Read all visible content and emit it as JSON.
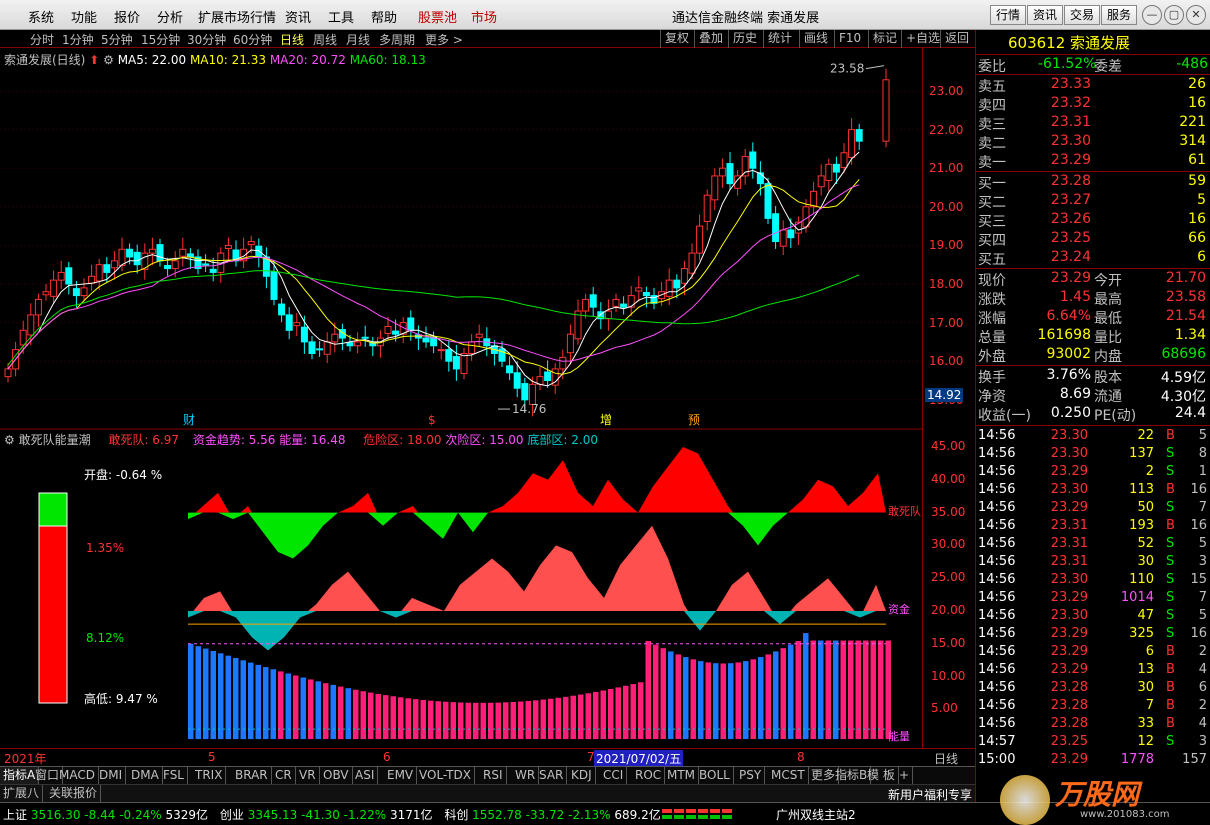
{
  "menu": {
    "items": [
      "系统",
      "功能",
      "报价",
      "分析",
      "扩展市场行情",
      "资讯",
      "工具",
      "帮助"
    ],
    "red_items": [
      "股票池",
      "市场"
    ],
    "title": "通达信金融终端  索通发展",
    "buttons": [
      "行情",
      "资讯",
      "交易",
      "服务"
    ]
  },
  "timeframes": {
    "items": [
      "分时",
      "1分钟",
      "5分钟",
      "15分钟",
      "30分钟",
      "60分钟",
      "日线",
      "周线",
      "月线",
      "多周期",
      "更多 >"
    ],
    "selected": "日线",
    "tools": [
      "复权",
      "叠加",
      "历史",
      "统计",
      "画线",
      "F10",
      "标记",
      "+自选",
      "返回"
    ]
  },
  "main": {
    "stock_title": "索通发展(日线)",
    "ma5": "MA5: 22.00",
    "ma10": "MA10: 21.33",
    "ma20": "MA20: 20.72",
    "ma60": "MA60: 18.13",
    "high_label": "23.58",
    "low_label": "14.76",
    "price_tag": "14.92",
    "markers": [
      "财",
      "$",
      "增",
      "预"
    ],
    "axis": [
      "23.00",
      "22.00",
      "21.00",
      "20.00",
      "19.00",
      "18.00",
      "17.00",
      "16.00",
      "15.00"
    ]
  },
  "sub": {
    "title": "敢死队能量潮",
    "gsd": "敢死队: 6.97",
    "zjqs": "资金趋势: 5.56",
    "nl": "能量: 16.48",
    "wx": "危险区: 18.00",
    "cwx": "次险区: 15.00",
    "db": "底部区: 2.00",
    "kp": "开盘: -0.64 %",
    "p1": "1.35%",
    "p2": "8.12%",
    "gd": "高低: 9.47 %",
    "lab_gsd": "敢死队",
    "lab_zj": "资金",
    "lab_nl": "能量",
    "axis": [
      "45.00",
      "40.00",
      "35.00",
      "30.00",
      "25.00",
      "20.00",
      "15.00",
      "10.00",
      "5.00"
    ]
  },
  "dates": {
    "year": "2021年",
    "m5": "5",
    "m6": "6",
    "m7": "7",
    "m8": "8",
    "sel": "2021/07/02/五",
    "period": "日线"
  },
  "indicators": {
    "items": [
      "指标A",
      "窗口",
      "MACD",
      "DMI",
      "DMA",
      "FSL",
      "TRIX",
      "BRAR",
      "CR",
      "VR",
      "OBV",
      "ASI",
      "EMV",
      "VOL-TDX",
      "RSI",
      "WR",
      "SAR",
      "KDJ",
      "CCI",
      "ROC",
      "MTM",
      "BOLL",
      "PSY",
      "MCST",
      "更多",
      "指标B",
      "模 板",
      "+"
    ],
    "ext": [
      "扩展八",
      "关联报价"
    ],
    "ad": "新用户福利专享"
  },
  "quote": {
    "code_name": "603612 索通发展",
    "wb_label": "委比",
    "wb": "-61.52%",
    "wc_label": "委差",
    "wc": "-486",
    "asks": [
      [
        "卖五",
        "23.33",
        "26"
      ],
      [
        "卖四",
        "23.32",
        "16"
      ],
      [
        "卖三",
        "23.31",
        "221"
      ],
      [
        "卖二",
        "23.30",
        "314"
      ],
      [
        "卖一",
        "23.29",
        "61"
      ]
    ],
    "bids": [
      [
        "买一",
        "23.28",
        "59"
      ],
      [
        "买二",
        "23.27",
        "5"
      ],
      [
        "买三",
        "23.26",
        "16"
      ],
      [
        "买四",
        "23.25",
        "66"
      ],
      [
        "买五",
        "23.24",
        "6"
      ]
    ],
    "stats": [
      [
        "现价",
        "23.29",
        "今开",
        "21.70"
      ],
      [
        "涨跌",
        "1.45",
        "最高",
        "23.58"
      ],
      [
        "涨幅",
        "6.64%",
        "最低",
        "21.54"
      ],
      [
        "总量",
        "161698",
        "量比",
        "1.34"
      ],
      [
        "外盘",
        "93002",
        "内盘",
        "68696"
      ]
    ],
    "stats2": [
      [
        "换手",
        "3.76%",
        "股本",
        "4.59亿"
      ],
      [
        "净资",
        "8.69",
        "流通",
        "4.30亿"
      ],
      [
        "收益(一)",
        "0.250",
        "PE(动)",
        "24.4"
      ]
    ]
  },
  "ticks": [
    [
      "14:56",
      "23.30",
      "22",
      "B",
      "5"
    ],
    [
      "14:56",
      "23.30",
      "137",
      "S",
      "8"
    ],
    [
      "14:56",
      "23.29",
      "2",
      "S",
      "1"
    ],
    [
      "14:56",
      "23.30",
      "113",
      "B",
      "16"
    ],
    [
      "14:56",
      "23.29",
      "50",
      "S",
      "7"
    ],
    [
      "14:56",
      "23.31",
      "193",
      "B",
      "16"
    ],
    [
      "14:56",
      "23.31",
      "52",
      "S",
      "5"
    ],
    [
      "14:56",
      "23.31",
      "30",
      "S",
      "3"
    ],
    [
      "14:56",
      "23.30",
      "110",
      "S",
      "15"
    ],
    [
      "14:56",
      "23.29",
      "1014",
      "S",
      "7"
    ],
    [
      "14:56",
      "23.30",
      "47",
      "S",
      "5"
    ],
    [
      "14:56",
      "23.29",
      "325",
      "S",
      "16"
    ],
    [
      "14:56",
      "23.29",
      "6",
      "B",
      "2"
    ],
    [
      "14:56",
      "23.29",
      "13",
      "B",
      "4"
    ],
    [
      "14:56",
      "23.28",
      "30",
      "B",
      "6"
    ],
    [
      "14:56",
      "23.28",
      "7",
      "B",
      "2"
    ],
    [
      "14:56",
      "23.28",
      "33",
      "B",
      "4"
    ],
    [
      "14:57",
      "23.25",
      "12",
      "S",
      "3"
    ],
    [
      "15:00",
      "23.29",
      "1778",
      "",
      "157"
    ]
  ],
  "status": {
    "sh_label": "上证",
    "sh": "3516.30",
    "sh_ch": "-8.44",
    "sh_pct": "-0.24%",
    "sh_amt": "5329亿",
    "cy_label": "创业",
    "cy": "3345.13",
    "cy_ch": "-41.30",
    "cy_pct": "-1.22%",
    "cy_amt": "3171亿",
    "kc_label": "科创",
    "kc": "1552.78",
    "kc_ch": "-33.72",
    "kc_pct": "-2.13%",
    "kc_amt": "689.2亿",
    "site": "广州双线主站2",
    "logo": "万股网",
    "url": "www.201083.com"
  },
  "colors": {
    "up": "#ff3232",
    "down": "#00ffff",
    "ma5": "#ffffff",
    "ma10": "#ffff00",
    "ma20": "#ff50ff",
    "ma60": "#00e600"
  }
}
